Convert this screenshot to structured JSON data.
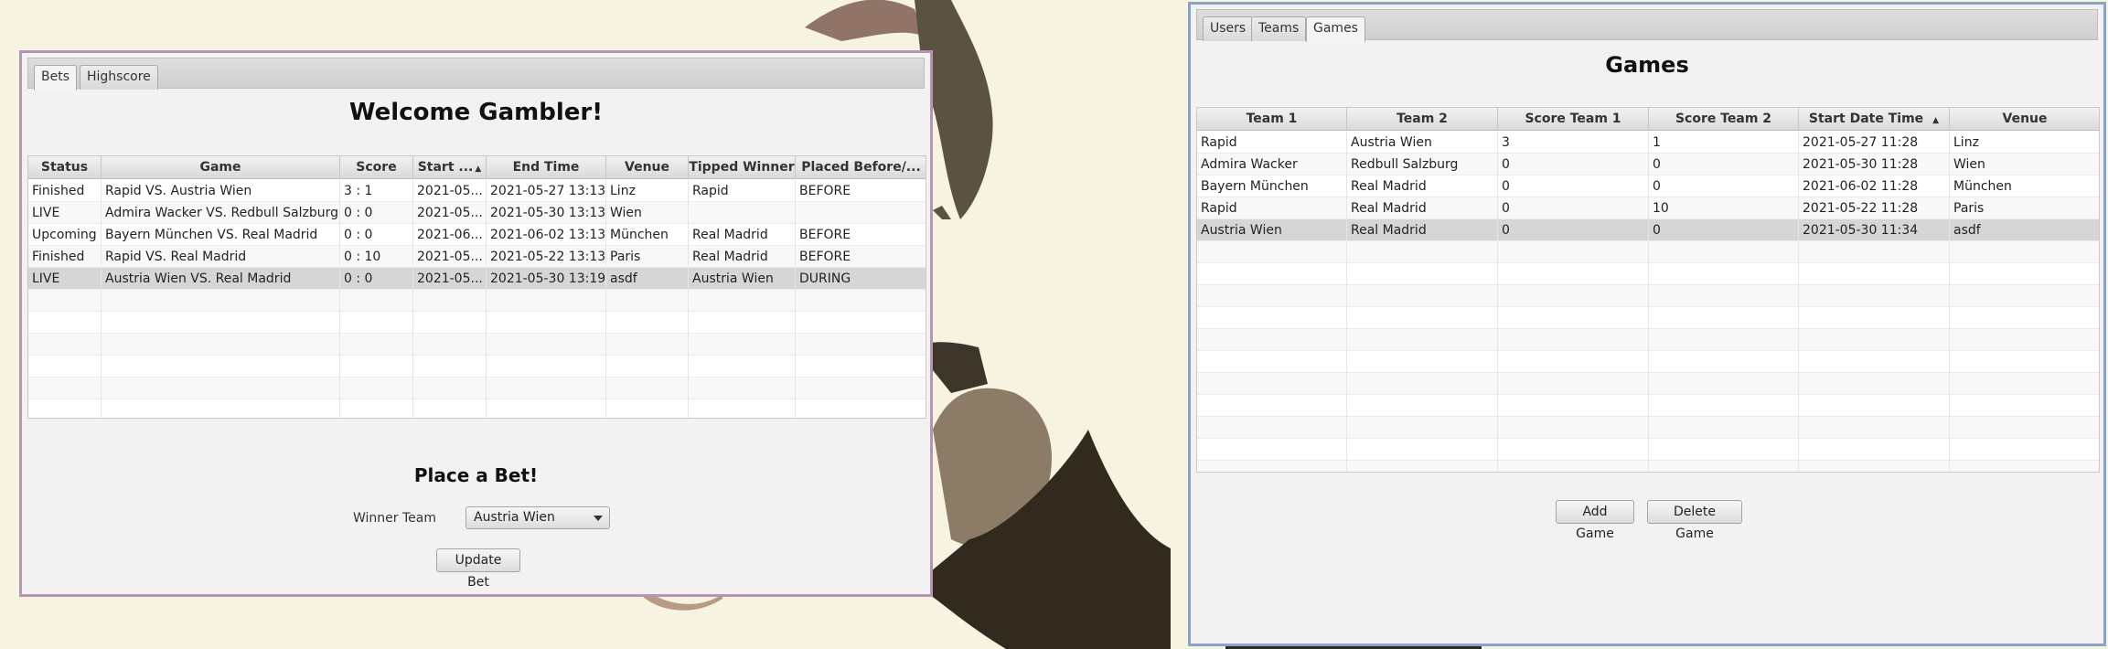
{
  "colors": {
    "desktop": "#f6f3e0",
    "bets_window_border": "#b694b4",
    "admin_window_border": "#8aa4c8",
    "selected_row": "#d6d6d6"
  },
  "bets_window": {
    "tabs": [
      "Bets",
      "Highscore"
    ],
    "active_tab": "Bets",
    "heading": "Welcome Gambler!",
    "table": {
      "columns": [
        "Status",
        "Game",
        "Score",
        "Start ...",
        "End Time",
        "Venue",
        "Tipped Winner",
        "Placed Before/..."
      ],
      "sorted_column": "Start ...",
      "sort_direction": "ascending",
      "rows": [
        [
          "Finished",
          "Rapid VS. Austria Wien",
          "3 : 1",
          "2021-05...",
          "2021-05-27 13:13",
          "Linz",
          "Rapid",
          "BEFORE"
        ],
        [
          "LIVE",
          "Admira Wacker VS. Redbull Salzburg",
          "0 : 0",
          "2021-05...",
          "2021-05-30 13:13",
          "Wien",
          "",
          ""
        ],
        [
          "Upcoming",
          "Bayern München VS. Real Madrid",
          "0 : 0",
          "2021-06...",
          "2021-06-02 13:13",
          "München",
          "Real Madrid",
          "BEFORE"
        ],
        [
          "Finished",
          "Rapid VS. Real Madrid",
          "0 : 10",
          "2021-05...",
          "2021-05-22 13:13",
          "Paris",
          "Real Madrid",
          "BEFORE"
        ],
        [
          "LIVE",
          "Austria Wien VS. Real Madrid",
          "0 : 0",
          "2021-05...",
          "2021-05-30 13:19",
          "asdf",
          "Austria Wien",
          "DURING"
        ]
      ],
      "selected_row": 4
    },
    "place_bet": {
      "heading": "Place a Bet!",
      "winner_label": "Winner Team",
      "winner_value": "Austria Wien",
      "update_button": "Update Bet"
    }
  },
  "admin_window": {
    "tabs": [
      "Users",
      "Teams",
      "Games"
    ],
    "active_tab": "Games",
    "heading": "Games",
    "table": {
      "columns": [
        "Team 1",
        "Team 2",
        "Score Team 1",
        "Score Team 2",
        "Start Date Time",
        "Venue"
      ],
      "sorted_column": "Start Date Time",
      "sort_direction": "ascending",
      "rows": [
        [
          "Rapid",
          "Austria Wien",
          "3",
          "1",
          "2021-05-27 11:28",
          "Linz"
        ],
        [
          "Admira Wacker",
          "Redbull Salzburg",
          "0",
          "0",
          "2021-05-30 11:28",
          "Wien"
        ],
        [
          "Bayern München",
          "Real Madrid",
          "0",
          "0",
          "2021-06-02 11:28",
          "München"
        ],
        [
          "Rapid",
          "Real Madrid",
          "0",
          "10",
          "2021-05-22 11:28",
          "Paris"
        ],
        [
          "Austria Wien",
          "Real Madrid",
          "0",
          "0",
          "2021-05-30 11:34",
          "asdf"
        ]
      ],
      "selected_row": 4
    },
    "add_button": "Add Game",
    "delete_button": "Delete Game"
  }
}
